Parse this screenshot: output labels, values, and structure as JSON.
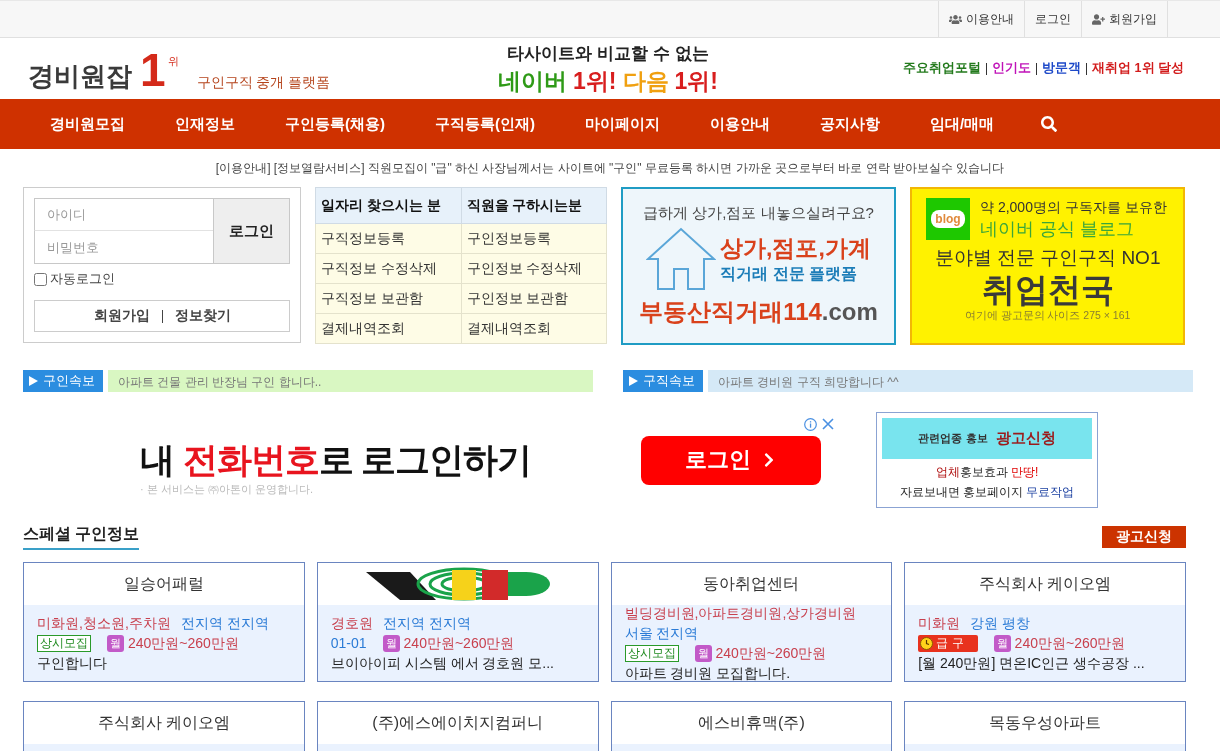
{
  "top_bar": {
    "links": [
      {
        "kind": "guide",
        "label": "이용안내"
      },
      {
        "kind": "login",
        "label": "로그인"
      },
      {
        "kind": "signup",
        "label": "회원가입"
      }
    ]
  },
  "header": {
    "logo": {
      "name": "경비원잡",
      "rank": "1",
      "rank_suffix": "위",
      "tagline": "구인구직 중개 플랫폼"
    },
    "slogan": {
      "line_1": "타사이트와 비교할 수 없는",
      "line_2": [
        {
          "text": "네이버",
          "color": "#2e9a16"
        },
        {
          "text": "1위!",
          "color": "#d81e1e"
        },
        {
          "text": "다음",
          "color": "#f0a010"
        },
        {
          "text": "1위!",
          "color": "#d81e1e"
        }
      ]
    },
    "highlights": [
      {
        "label": "주요취업포털",
        "color": "#237a1c"
      },
      {
        "label": "인기도",
        "color": "#c012b8"
      },
      {
        "label": "방문객",
        "color": "#1c48c8"
      },
      {
        "label": "재취업 1위 달성",
        "color": "#d21b1b"
      }
    ]
  },
  "nav": {
    "items": [
      "경비원모집",
      "인재정보",
      "구인등록(채용)",
      "구직등록(인재)",
      "마이페이지",
      "이용안내",
      "공지사항",
      "임대/매매"
    ]
  },
  "notice": "[이용안내] [정보열람서비스] 직원모집이 \"급\" 하신 사장님께서는 사이트에 \"구인\" 무료등록 하시면 가까운 곳으로부터 바로 연락 받아보실수 있습니다",
  "login": {
    "id_placeholder": "아이디",
    "password_placeholder": "비밀번호",
    "button": "로그인",
    "auto_login": {
      "label": "자동로그인",
      "checked": false
    },
    "links": [
      "회원가입",
      "정보찾기"
    ]
  },
  "quick_menu": {
    "columns": [
      {
        "heading": "일자리 찾으시는 분",
        "items": [
          "구직정보등록",
          "구직정보 수정삭제",
          "구직정보 보관함",
          "결제내역조회"
        ]
      },
      {
        "heading": "직원을 구하시는분",
        "items": [
          "구인정보등록",
          "구인정보 수정삭제",
          "구인정보 보관함",
          "결제내역조회"
        ]
      }
    ]
  },
  "real_estate_banner": {
    "question": "급하게 상가,점포 내놓으실려구요?",
    "headline": "상가,점포,가계",
    "subline": "직거래 전문 플랫폼",
    "site_name": "부동산직거래114",
    "site_suffix": ".com"
  },
  "blog_banner": {
    "badge": "blog",
    "line_1": "약 2,000명의 구독자를 보유한",
    "line_2": "네이버 공식 블로그",
    "line_3": "분야별 전문 구인구직 NO1",
    "title": "취업천국",
    "footnote": "여기에 광고문의 사이즈 275 × 161"
  },
  "tickers": [
    {
      "kind": "hiring",
      "label": "구인속보",
      "text": "아파트 건물 관리 반장님 구인 합니다.."
    },
    {
      "kind": "seeking",
      "label": "구직속보",
      "text": "아파트 경비원 구직 희망합니다 ^^"
    }
  ],
  "ad": {
    "headline": [
      {
        "text": "내 ",
        "highlight": false
      },
      {
        "text": "전화번호",
        "highlight": true
      },
      {
        "text": "로 로그인하기",
        "highlight": false
      }
    ],
    "note": "· 본 서비스는 ㈜아톤이 운영합니다.",
    "button": "로그인"
  },
  "promo": {
    "tag": "관련업종 홍보",
    "title": "광고신청",
    "lines": [
      [
        {
          "text": "업체",
          "kind": "brand"
        },
        {
          "text": "홍보효과 ",
          "kind": "plain"
        },
        {
          "text": "만땅!",
          "kind": "alert"
        }
      ],
      [
        {
          "text": "자료보내면 홍보페이지 ",
          "kind": "plain"
        },
        {
          "text": "무료작업",
          "kind": "link"
        }
      ]
    ]
  },
  "special": {
    "title": "스페셜 구인정보",
    "apply_button": "광고신청",
    "cards": [
      {
        "kind": "text",
        "title": "일승어패럴",
        "jobs": "미화원,청소원,주차원",
        "region": "전지역 전지역",
        "tag": {
          "kind": "always",
          "label": "상시모집"
        },
        "pay_type": "월",
        "salary": "240만원~260만원",
        "summary": "구인합니다"
      },
      {
        "kind": "logo",
        "jobs": "경호원",
        "region": "전지역 전지역",
        "date": "01-01",
        "pay_type": "월",
        "salary": "240만원~260만원",
        "summary": "브이아이피 시스템 에서 경호원 모..."
      },
      {
        "kind": "text",
        "title": "동아취업센터",
        "jobs": "빌딩경비원,아파트경비원,상가경비원",
        "region": "서울 전지역",
        "tag": {
          "kind": "always",
          "label": "상시모집"
        },
        "pay_type": "월",
        "salary": "240만원~260만원",
        "summary": "아파트 경비원 모집합니다."
      },
      {
        "kind": "text",
        "title": "주식회사 케이오엠",
        "jobs": "미화원",
        "region": "강원 평창",
        "tag": {
          "kind": "urgent",
          "label": "급 구"
        },
        "pay_type": "월",
        "salary": "240만원~260만원",
        "summary": "[월 240만원] 면온IC인근 생수공장 ..."
      },
      {
        "kind": "text",
        "title": "주식회사 케이오엠"
      },
      {
        "kind": "text",
        "title": "(주)에스에이치지컴퍼니"
      },
      {
        "kind": "text",
        "title": "에스비휴맥(주)"
      },
      {
        "kind": "text",
        "title": "목동우성아파트"
      }
    ]
  }
}
